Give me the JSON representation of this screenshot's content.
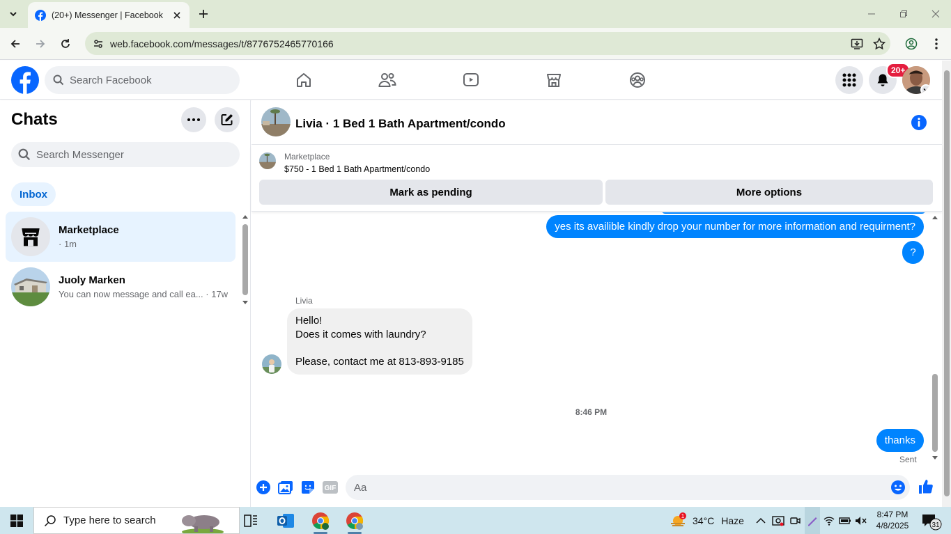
{
  "browser": {
    "tab_title": "(20+) Messenger | Facebook",
    "url": "web.facebook.com/messages/t/8776752465770166"
  },
  "fb_header": {
    "search_placeholder": "Search Facebook",
    "notification_badge": "20+"
  },
  "left_panel": {
    "title": "Chats",
    "search_placeholder": "Search Messenger",
    "filter_label": "Inbox",
    "chats": [
      {
        "name": "Marketplace",
        "preview": "· 1m"
      },
      {
        "name": "Juoly Marken",
        "preview": "You can now message and call ea... · 17w"
      }
    ]
  },
  "conversation": {
    "title": "Livia · 1 Bed 1 Bath Apartment/condo",
    "listing": {
      "label": "Marketplace",
      "title": "$750 - 1 Bed 1 Bath Apartment/condo",
      "primary_button": "Mark as pending",
      "secondary_button": "More options"
    },
    "messages": {
      "out_1": "yes its availible kindly drop your number for more information and requirment?",
      "out_2": "?",
      "sender": "Livia",
      "in_1_line1": "Hello!",
      "in_1_line2": "Does it comes with laundry?",
      "in_1_line3": "Please, contact me at 813-893-9185",
      "timestamp": "8:46 PM",
      "out_3": "thanks",
      "status": "Sent"
    },
    "composer_placeholder": "Aa",
    "accent_color": "#0084ff"
  },
  "taskbar": {
    "search_placeholder": "Type here to search",
    "weather_temp": "34°C",
    "weather_desc": "Haze",
    "weather_badge": "1",
    "time": "8:47 PM",
    "date": "4/8/2025",
    "notification_count": "31"
  }
}
